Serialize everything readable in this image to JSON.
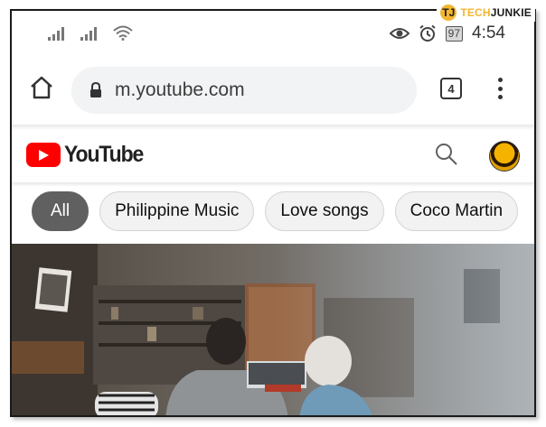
{
  "watermark": {
    "mark": "TJ",
    "brand_prefix": "TECH",
    "brand_suffix": "JUNKIE"
  },
  "status_bar": {
    "battery": "97",
    "time": "4:54"
  },
  "browser": {
    "url": "m.youtube.com",
    "tab_count": "4"
  },
  "youtube": {
    "logo_text": "YouTube",
    "chips": [
      {
        "label": "All",
        "active": true
      },
      {
        "label": "Philippine Music",
        "active": false
      },
      {
        "label": "Love songs",
        "active": false
      },
      {
        "label": "Coco Martin",
        "active": false
      }
    ]
  },
  "colors": {
    "youtube_red": "#ff0000",
    "chip_active": "#606060",
    "omnibox_bg": "#f1f3f4",
    "brand_gold": "#f2b632"
  },
  "icons": [
    "signal-icon",
    "wifi-icon",
    "eye-icon",
    "alarm-icon",
    "battery-icon",
    "home-icon",
    "lock-icon",
    "tabs-icon",
    "menu-icon",
    "youtube-play-icon",
    "search-icon",
    "avatar-icon"
  ]
}
